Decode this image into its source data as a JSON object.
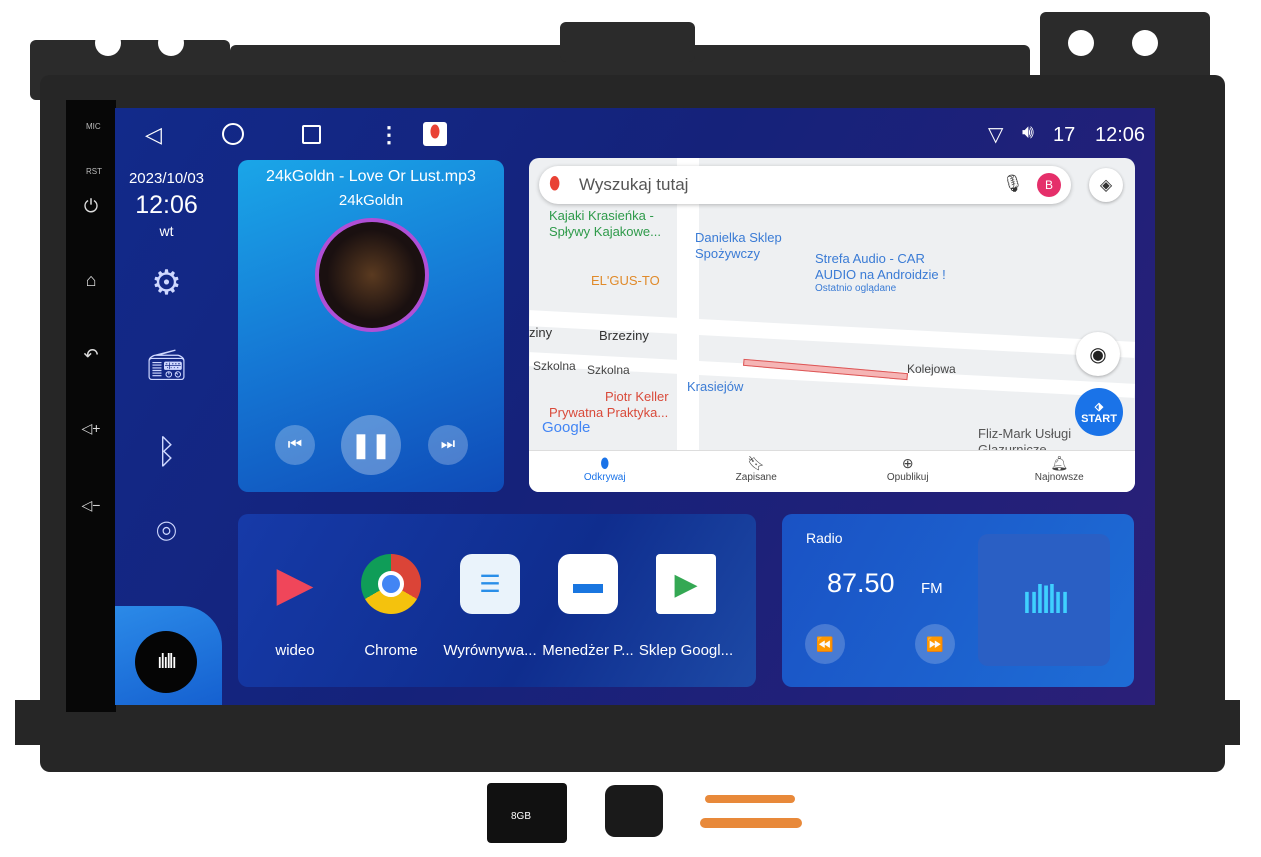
{
  "status_bar": {
    "nav_icons": [
      "back-icon",
      "home-icon",
      "recents-icon",
      "menu-icon",
      "maps-icon"
    ],
    "volume": "17",
    "time": "12:06"
  },
  "hardware_buttons": {
    "mic_label": "MIC",
    "rst_label": "RST"
  },
  "sidebar": {
    "date": "2023/10/03",
    "time": "12:06",
    "weekday": "wt",
    "items": [
      "settings-icon",
      "radio-icon",
      "bluetooth-icon",
      "location-icon"
    ]
  },
  "music": {
    "title": "24kGoldn - Love Or Lust.mp3",
    "artist": "24kGoldn"
  },
  "map": {
    "search_placeholder": "Wyszukaj tutaj",
    "avatar": "B",
    "places": {
      "kajaki": "Kajaki Krasieńka -",
      "kajaki2": "Spływy Kajakowe...",
      "danielka": "Danielka Sklep",
      "danielka2": "Spożywczy",
      "strefa": "Strefa Audio - CAR",
      "strefa2": "AUDIO na Androidzie !",
      "strefa3": "Ostatnio oglądane",
      "elgusto": "EL'GUS-TO",
      "brzeziny": "Brzeziny",
      "brzeziny0": "ziny",
      "szkolna": "Szkolna",
      "szkolna2": "Szkolna",
      "kolejowa": "Kolejowa",
      "krasiejow": "Krasiejów",
      "piotr": "Piotr Keller",
      "piotr2": "Prywatna Praktyka...",
      "fliz": "Fliz-Mark Usługi",
      "fliz2": "Glazurnicze",
      "google": "Google"
    },
    "start_label": "START",
    "nav": [
      "Odkrywaj",
      "Zapisane",
      "Opublikuj",
      "Najnowsze"
    ]
  },
  "apps": [
    {
      "label": "wideo"
    },
    {
      "label": "Chrome"
    },
    {
      "label": "Wyrównywa..."
    },
    {
      "label": "Menedżer P..."
    },
    {
      "label": "Sklep Googl..."
    }
  ],
  "radio": {
    "title": "Radio",
    "frequency": "87.50",
    "band": "FM"
  },
  "accessories": {
    "sd_card": "8GB"
  }
}
